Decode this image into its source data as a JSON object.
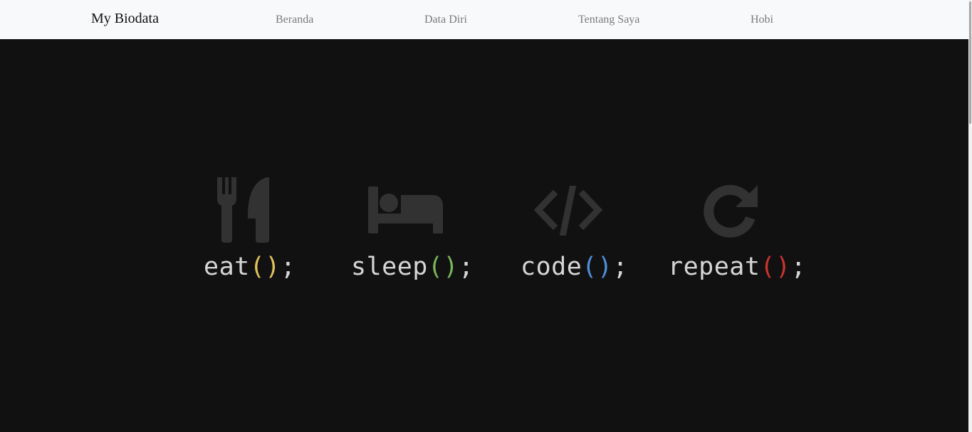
{
  "navbar": {
    "brand": "My Biodata",
    "links": [
      "Beranda",
      "Data Diri",
      "Tentang Saya",
      "Hobi"
    ]
  },
  "hero": {
    "items": [
      {
        "icon": "utensils-icon",
        "word": "eat",
        "paren": "()",
        "semi": ";",
        "paren_color": "#e2c35b"
      },
      {
        "icon": "bed-icon",
        "word": "sleep",
        "paren": "()",
        "semi": ";",
        "paren_color": "#7bb55a"
      },
      {
        "icon": "code-icon",
        "word": "code",
        "paren": "()",
        "semi": ";",
        "paren_color": "#4f8fd8"
      },
      {
        "icon": "redo-icon",
        "word": "repeat",
        "paren": "()",
        "semi": ";",
        "paren_color": "#c9342f"
      }
    ],
    "icon_color": "#323232"
  }
}
